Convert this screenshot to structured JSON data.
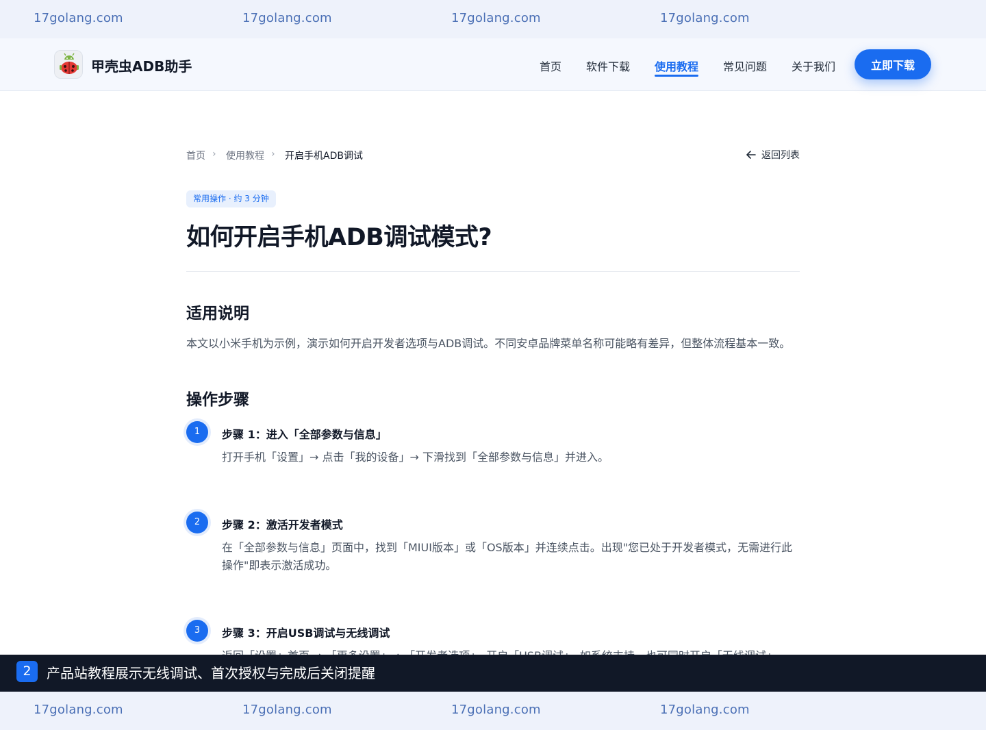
{
  "watermark": {
    "text": "17golang.com"
  },
  "header": {
    "brand": "甲壳虫ADB助手",
    "nav": [
      "首页",
      "软件下载",
      "使用教程",
      "常见问题",
      "关于我们"
    ],
    "active_nav": "使用教程",
    "cta_label": "立即下载"
  },
  "breadcrumb": {
    "items": [
      "首页",
      "使用教程",
      "开启手机ADB调试"
    ],
    "back_label": "返回列表"
  },
  "article": {
    "tag": "常用操作 · 约 3 分钟",
    "title": "如何开启手机ADB调试模式?",
    "section1_heading": "适用说明",
    "section1_text": "本文以小米手机为示例，演示如何开启开发者选项与ADB调试。不同安卓品牌菜单名称可能略有差异，但整体流程基本一致。",
    "section2_heading": "操作步骤",
    "steps": [
      {
        "num": "1",
        "title": "步骤 1：进入「全部参数与信息」",
        "desc": "打开手机「设置」→ 点击「我的设备」→ 下滑找到「全部参数与信息」并进入。"
      },
      {
        "num": "2",
        "title": "步骤 2：激活开发者模式",
        "desc": "在「全部参数与信息」页面中，找到「MIUI版本」或「OS版本」并连续点击。出现\"您已处于开发者模式，无需进行此操作\"即表示激活成功。"
      },
      {
        "num": "3",
        "title": "步骤 3：开启USB调试与无线调试",
        "desc": "返回「设置」首页 → 「更多设置」→ 「开发者选项」，开启「USB调试」，如系统支持，也可同时开启「无线调试」。"
      }
    ]
  },
  "caption": {
    "num": "2",
    "text": "产品站教程展示无线调试、首次授权与完成后关闭提醒"
  },
  "colors": {
    "accent": "#1a6cf0",
    "caption_bg": "#111827",
    "watermark_bg": "#eef2fb"
  }
}
